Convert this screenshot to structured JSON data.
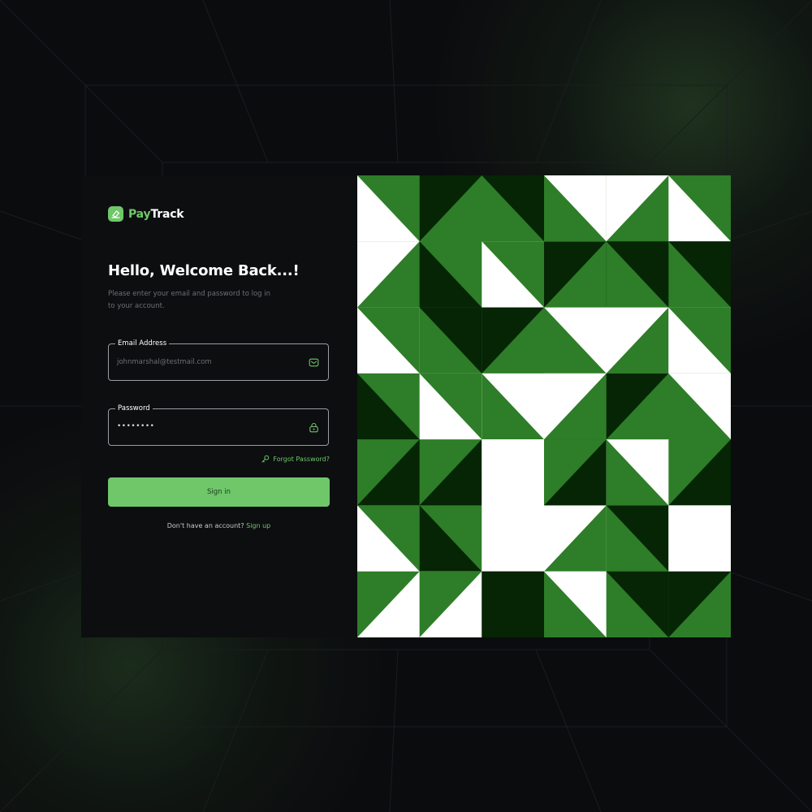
{
  "brand": {
    "name_part1": "Pay",
    "name_part2": "Track",
    "accent_color": "#6fc76a",
    "icon": "wallet-icon"
  },
  "login": {
    "title": "Hello, Welcome Back...!",
    "subtitle": "Please enter your email and password to log in to your account.",
    "email": {
      "label": "Email Address",
      "value": "johnmarshal@testmail.com",
      "icon": "mail-icon"
    },
    "password": {
      "label": "Password",
      "value": "••••••••",
      "icon": "lock-icon"
    },
    "forgot_label": "Forgot Password?",
    "forgot_icon": "key-icon",
    "signin_label": "Sign in",
    "signup_prompt": "Don't have an account?",
    "signup_label": "Sign up"
  },
  "pattern": {
    "colors": {
      "white": "#ffffff",
      "green": "#2e7d28",
      "dark": "#052505"
    }
  }
}
